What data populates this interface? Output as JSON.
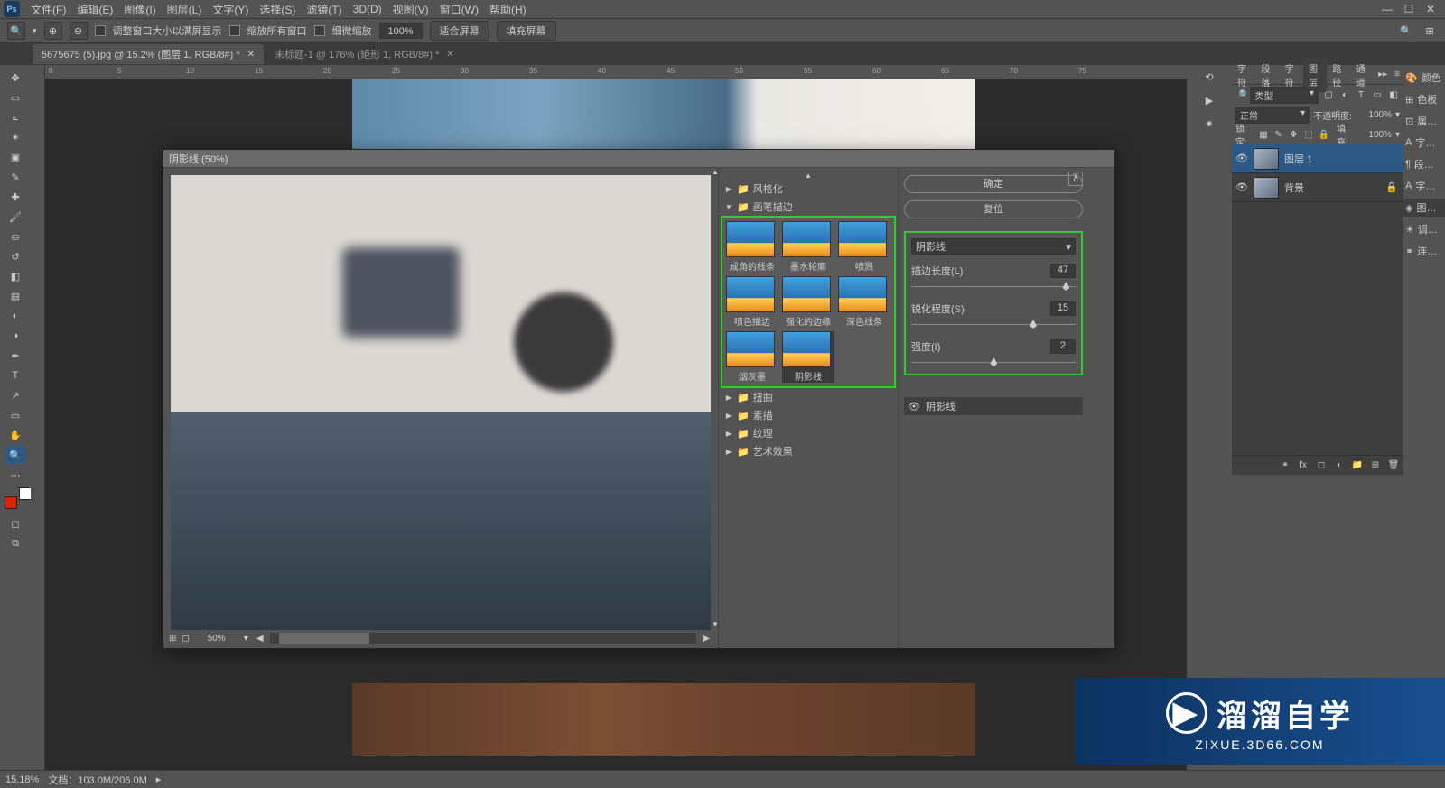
{
  "menu": {
    "items": [
      "文件(F)",
      "编辑(E)",
      "图像(I)",
      "图层(L)",
      "文字(Y)",
      "选择(S)",
      "滤镜(T)",
      "3D(D)",
      "视图(V)",
      "窗口(W)",
      "帮助(H)"
    ]
  },
  "opt": {
    "resize_win": "调整窗口大小以满屏显示",
    "all_win": "缩放所有窗口",
    "scrubby": "细微缩放",
    "zoom_pct": "100%",
    "fit": "适合屏幕",
    "fill": "填充屏幕"
  },
  "tabs": [
    {
      "label": "5675675 (5).jpg @ 15.2% (图层 1, RGB/8#) *"
    },
    {
      "label": "未标题-1 @ 176% (矩形 1, RGB/8#) *"
    }
  ],
  "ruler_h": [
    "0",
    "5",
    "10",
    "15",
    "20",
    "25",
    "30",
    "35",
    "40",
    "45",
    "50",
    "55",
    "60",
    "65",
    "70",
    "75"
  ],
  "status": {
    "zoom": "15.18%",
    "doc": "文档：103.0M/206.0M"
  },
  "panels": {
    "tabs1": [
      "字符",
      "段落",
      "字符",
      "图层",
      "路径",
      "通道"
    ],
    "kind_label": "类型",
    "blend": "正常",
    "opacity_lbl": "不透明度:",
    "opacity": "100%",
    "lock_lbl": "锁定:",
    "fill_lbl": "填充:",
    "fill": "100%",
    "layers": [
      {
        "name": "图层 1"
      },
      {
        "name": "背景"
      }
    ]
  },
  "dock_labels": [
    "颜色",
    "色板",
    "属…",
    "字…",
    "段…",
    "字…",
    "图…",
    "调…",
    "连…"
  ],
  "dialog": {
    "title": "阴影线 (50%)",
    "preview_zoom": "50%",
    "folders": [
      {
        "name": "风格化",
        "open": false
      },
      {
        "name": "画笔描边",
        "open": true
      },
      {
        "name": "扭曲",
        "open": false
      },
      {
        "name": "素描",
        "open": false
      },
      {
        "name": "纹理",
        "open": false
      },
      {
        "name": "艺术效果",
        "open": false
      }
    ],
    "thumbs": [
      "成角的线条",
      "墨水轮廓",
      "喷溅",
      "喷色描边",
      "强化的边缘",
      "深色线条",
      "烟灰墨",
      "阴影线"
    ],
    "ok": "确定",
    "reset": "复位",
    "filter_name": "阴影线",
    "params": [
      {
        "label": "描边长度(L)",
        "value": "47",
        "pos": 92
      },
      {
        "label": "锐化程度(S)",
        "value": "15",
        "pos": 72
      },
      {
        "label": "强度(I)",
        "value": "2",
        "pos": 48
      }
    ],
    "effect_entry": "阴影线"
  },
  "watermark": {
    "brand": "溜溜自学",
    "url": "ZIXUE.3D66.COM"
  }
}
